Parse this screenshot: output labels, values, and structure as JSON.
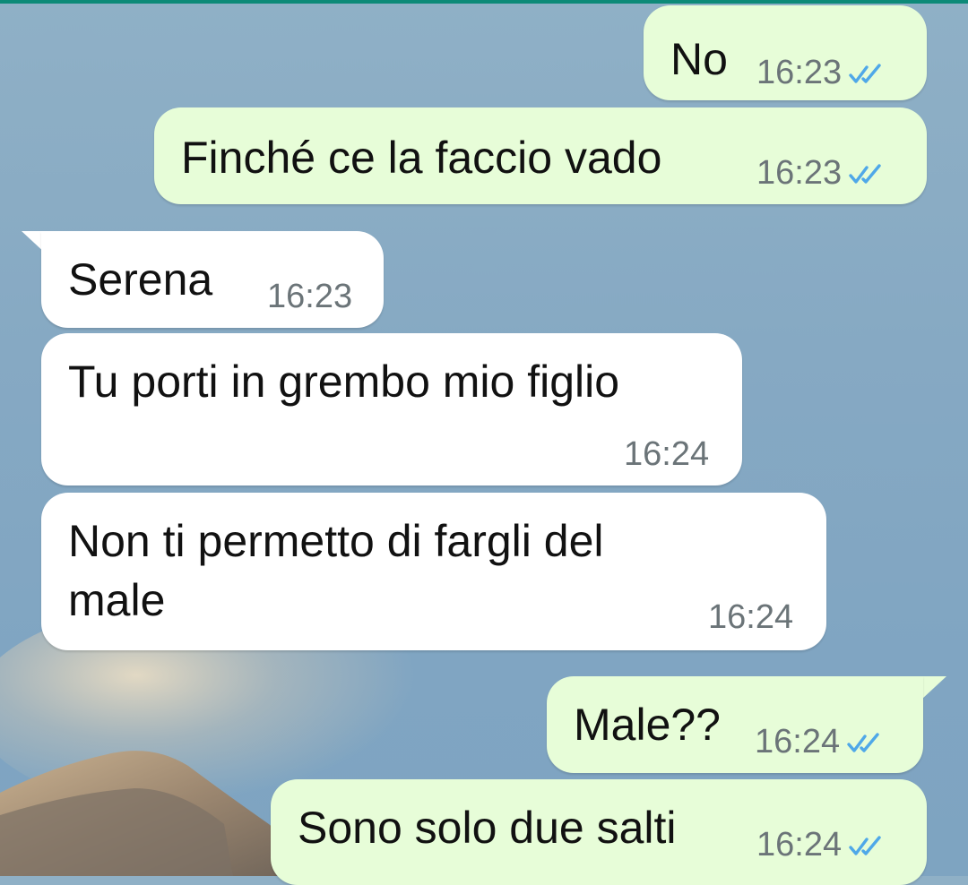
{
  "chat": {
    "messages": [
      {
        "direction": "outgoing",
        "lines": [
          "No"
        ],
        "time": "16:23",
        "status": "read"
      },
      {
        "direction": "outgoing",
        "lines": [
          "Finché ce la faccio vado"
        ],
        "time": "16:23",
        "status": "read"
      },
      {
        "direction": "incoming",
        "lines": [
          "Serena"
        ],
        "time": "16:23"
      },
      {
        "direction": "incoming",
        "lines": [
          "Tu porti in grembo mio figlio"
        ],
        "time": "16:24"
      },
      {
        "direction": "incoming",
        "lines": [
          "Non ti permetto di fargli del",
          "male"
        ],
        "time": "16:24"
      },
      {
        "direction": "outgoing",
        "lines": [
          "Male??"
        ],
        "time": "16:24",
        "status": "read"
      },
      {
        "direction": "outgoing",
        "lines": [
          "Sono solo due salti"
        ],
        "time": "16:24",
        "status": "read"
      }
    ]
  },
  "colors": {
    "outgoing_bubble": "#e7fdd8",
    "incoming_bubble": "#ffffff",
    "read_ticks": "#4fa8e8",
    "timestamp": "#6b7478",
    "top_bar": "#0d8a78"
  },
  "icons": {
    "read_receipt": "double-check-icon"
  }
}
